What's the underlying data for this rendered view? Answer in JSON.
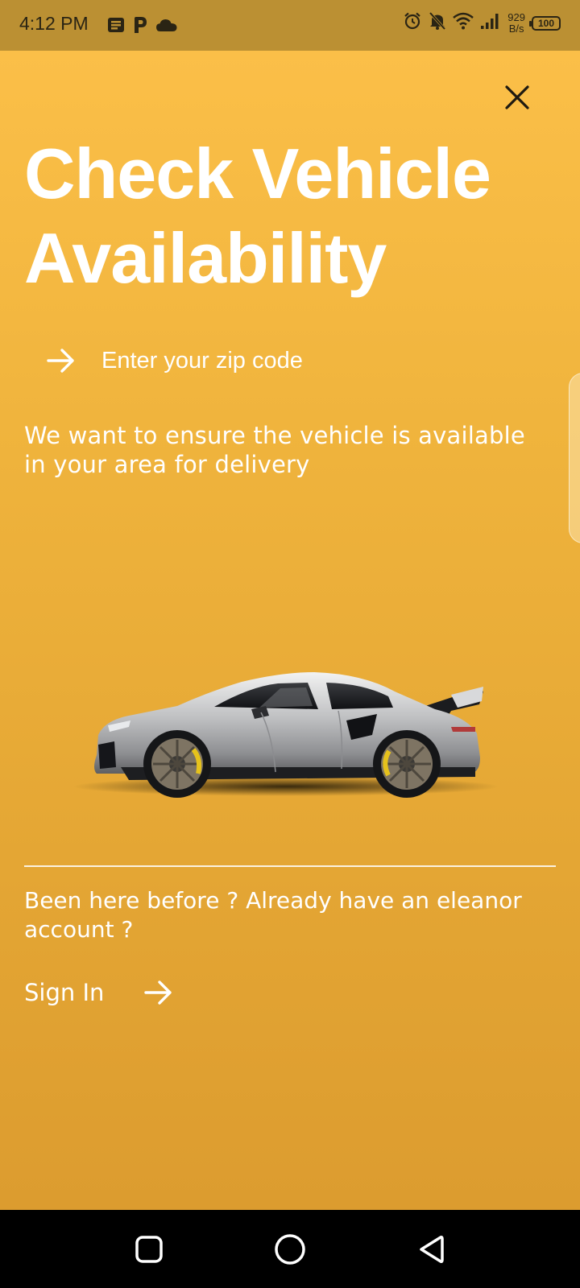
{
  "status_bar": {
    "time": "4:12 PM",
    "net_speed_value": "929",
    "net_speed_unit": "B/s",
    "battery": "100",
    "icons": [
      "notes-icon",
      "p-icon",
      "cloud-icon",
      "alarm-icon",
      "mute-icon",
      "wifi-icon",
      "signal-icon"
    ]
  },
  "header": {
    "close_icon": "close-icon"
  },
  "main": {
    "title": "Check Vehicle Availability",
    "zip_placeholder": "Enter your zip code",
    "zip_value": "",
    "description": "We want to ensure the vehicle is available in your area for delivery",
    "returning_prompt": "Been here before ? Already have an eleanor account ?",
    "sign_in_label": "Sign In"
  },
  "nav": {
    "recents_icon": "square-icon",
    "home_icon": "circle-icon",
    "back_icon": "triangle-back-icon"
  },
  "colors": {
    "accent_top": "#fbbf48",
    "accent_bottom": "#dc9c2f",
    "status_bar": "#bb9033",
    "text": "#ffffff"
  }
}
